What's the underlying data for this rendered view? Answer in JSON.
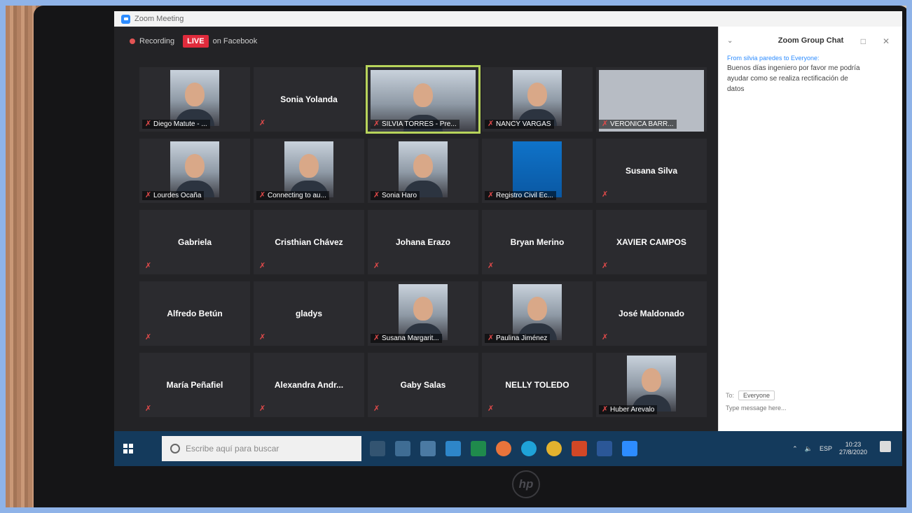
{
  "window": {
    "title": "Zoom Meeting"
  },
  "recording": {
    "label": "Recording",
    "live_badge": "LIVE",
    "platform": "on Facebook"
  },
  "participants": [
    {
      "name": "Diego Matute - ...",
      "video": true,
      "style": "person"
    },
    {
      "name": "Sonia Yolanda",
      "video": false
    },
    {
      "name": "SILVIA TORRES - Pre...",
      "video": true,
      "style": "person",
      "active": true
    },
    {
      "name": "NANCY VARGAS",
      "video": true,
      "style": "person"
    },
    {
      "name": "VERONICA BARR...",
      "video": true,
      "style": "gray"
    },
    {
      "name": "Lourdes Ocaña",
      "video": true,
      "style": "person"
    },
    {
      "name": "Connecting to au...",
      "video": true,
      "style": "person"
    },
    {
      "name": "Sonia Haro",
      "video": true,
      "style": "person"
    },
    {
      "name": "Registro Civil Ec...",
      "video": true,
      "style": "blue"
    },
    {
      "name": "Susana Silva",
      "video": false
    },
    {
      "name": "Gabriela",
      "video": false
    },
    {
      "name": "Cristhian Chávez",
      "video": false
    },
    {
      "name": "Johana Erazo",
      "video": false
    },
    {
      "name": "Bryan Merino",
      "video": false
    },
    {
      "name": "XAVIER CAMPOS",
      "video": false
    },
    {
      "name": "Alfredo Betún",
      "video": false
    },
    {
      "name": "gladys",
      "video": false
    },
    {
      "name": "Susana Margarit...",
      "video": true,
      "style": "person"
    },
    {
      "name": "Paulina Jiménez",
      "video": true,
      "style": "person"
    },
    {
      "name": "José Maldonado",
      "video": false
    },
    {
      "name": "María Peñafiel",
      "video": false
    },
    {
      "name": "Alexandra Andr...",
      "video": false
    },
    {
      "name": "Gaby Salas",
      "video": false
    },
    {
      "name": "NELLY TOLEDO",
      "video": false
    },
    {
      "name": "Huber Arevalo",
      "video": true,
      "style": "person"
    }
  ],
  "chat": {
    "title": "Zoom Group Chat",
    "from": "From silvia paredes to Everyone:",
    "message": "Buenos días ingeniero por favor me podría ayudar como se realiza rectificación de datos",
    "to_label": "To:",
    "to_value": "Everyone",
    "input_placeholder": "Type message here..."
  },
  "taskbar": {
    "search_placeholder": "Escribe aquí para buscar",
    "language": "ESP",
    "time": "10:23",
    "date": "27/8/2020"
  },
  "colors": {
    "live": "#e02b3c",
    "active_speaker": "#b8d45b",
    "taskbar": "#143a5c",
    "chat_accent": "#2d8cff"
  }
}
